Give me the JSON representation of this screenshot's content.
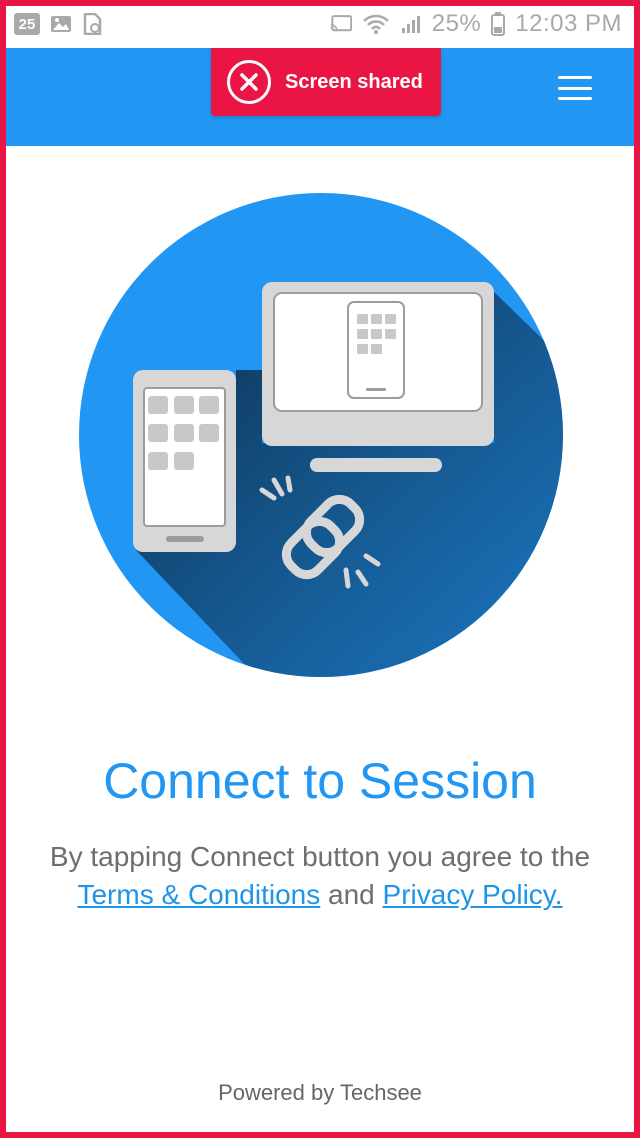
{
  "status_bar": {
    "left_badge": "25",
    "battery": "25%",
    "time": "12:03 PM",
    "icons": [
      "calendar-badge",
      "image-icon",
      "file-sync-icon",
      "cast-icon",
      "wifi-icon",
      "signal-icon",
      "battery-icon"
    ]
  },
  "app_bar": {
    "banner_label": "Screen shared",
    "banner_icon": "close-circle-icon",
    "menu_icon": "hamburger-menu-icon",
    "background_color": "#2196f3",
    "banner_color": "#ea1545"
  },
  "illustration": {
    "icons": [
      "phone-icon",
      "monitor-icon",
      "link-icon"
    ],
    "circle_color": "#2196f3"
  },
  "content": {
    "title": "Connect to Session",
    "desc_prefix": "By tapping Connect button you agree to the",
    "terms_link": "Terms & Conditions",
    "and_text": "and",
    "privacy_link": "Privacy Policy."
  },
  "footer": {
    "powered_by": "Powered by Techsee"
  }
}
